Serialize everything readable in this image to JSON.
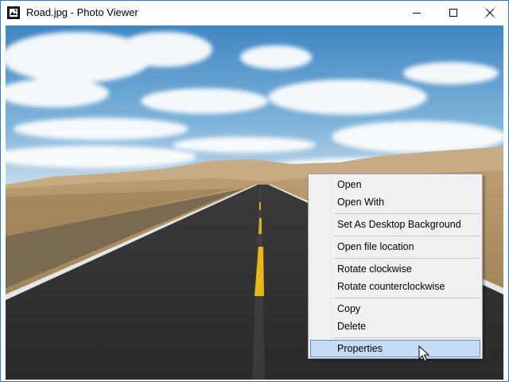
{
  "window": {
    "title": "Road.jpg - Photo Viewer",
    "accent": "#2b79d0",
    "controls": [
      "minimize-icon",
      "maximize-icon",
      "close-icon"
    ]
  },
  "photo": {
    "sky_top": "#4a90c8",
    "road": "#2e2e30",
    "center_line": "#e8b81a"
  },
  "context_menu": {
    "groups": [
      [
        "Open",
        "Open With"
      ],
      [
        "Set As Desktop Background"
      ],
      [
        "Open file location"
      ],
      [
        "Rotate clockwise",
        "Rotate counterclockwise"
      ],
      [
        "Copy",
        "Delete"
      ],
      [
        "Properties"
      ]
    ],
    "items": {
      "open": "Open",
      "open_with": "Open With",
      "set_background": "Set As Desktop Background",
      "open_location": "Open file location",
      "rotate_cw": "Rotate clockwise",
      "rotate_ccw": "Rotate counterclockwise",
      "copy": "Copy",
      "delete": "Delete",
      "properties": "Properties"
    },
    "highlighted": "Properties",
    "highlight_color": "#c6dcf6"
  }
}
